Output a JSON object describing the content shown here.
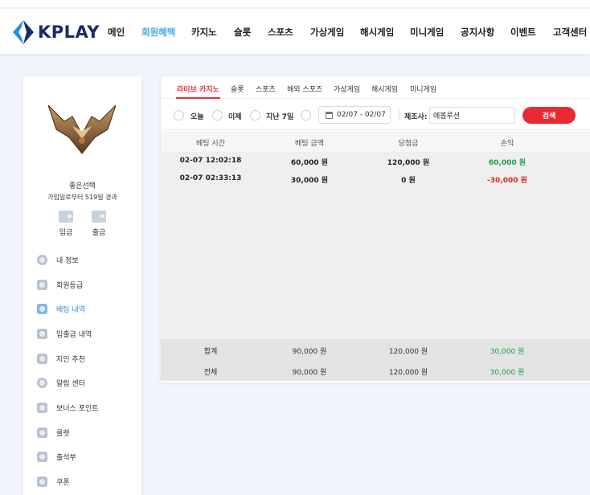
{
  "header": {
    "logo_text": "KPLAY",
    "nav": [
      "메인",
      "회원혜택",
      "카지노",
      "슬롯",
      "스포츠",
      "가상게임",
      "해시게임",
      "미니게임",
      "공지사항",
      "이벤트",
      "고객센터"
    ]
  },
  "sidebar": {
    "username": "좋은선택",
    "userinfo": "가입일로부터 519일 경과",
    "deposit_label": "입금",
    "withdraw_label": "출금",
    "menu": [
      {
        "label": "내 정보",
        "icon": "profile-icon"
      },
      {
        "label": "회원등급",
        "icon": "grade-icon"
      },
      {
        "label": "베팅 내역",
        "icon": "betting-history-icon"
      },
      {
        "label": "입출금 내역",
        "icon": "wallet-icon"
      },
      {
        "label": "지인 추천",
        "icon": "referral-icon"
      },
      {
        "label": "알림 센터",
        "icon": "notification-icon"
      },
      {
        "label": "보너스 포인트",
        "icon": "bonus-icon"
      },
      {
        "label": "룰렛",
        "icon": "roulette-icon"
      },
      {
        "label": "출석부",
        "icon": "attendance-icon"
      },
      {
        "label": "쿠폰",
        "icon": "coupon-icon"
      }
    ],
    "active_index": 2
  },
  "tabs": [
    "라이브 카지노",
    "슬롯",
    "스포츠",
    "해외 스포츠",
    "가상게임",
    "해시게임",
    "미니게임"
  ],
  "filter": {
    "today": "오늘",
    "yesterday": "이제",
    "last7": "지난 7일",
    "date_range": "02/07 - 02/07",
    "maker_label": "제조사:",
    "maker_value": "에볼루션",
    "search_label": "검색"
  },
  "table": {
    "headers": [
      "베팅 시간",
      "베팅 금액",
      "당첨금",
      "손익"
    ],
    "rows": [
      {
        "time": "02-07 12:02:18",
        "bet": "60,000 원",
        "win": "120,000 원",
        "profit": "60,000 원",
        "sign": "pos"
      },
      {
        "time": "02-07 02:33:13",
        "bet": "30,000 원",
        "win": "0 원",
        "profit": "-30,000 원",
        "sign": "neg"
      }
    ],
    "subtotal": {
      "label": "합계",
      "bet": "90,000 원",
      "win": "120,000 원",
      "profit": "30,000 원"
    },
    "total": {
      "label": "전체",
      "bet": "90,000 원",
      "win": "120,000 원",
      "profit": "30,000 원"
    }
  },
  "colors": {
    "accent_red": "#ea2a33",
    "profit_green": "#1aa04a",
    "loss_red": "#e02424",
    "nav_active": "#5ab0e8"
  }
}
